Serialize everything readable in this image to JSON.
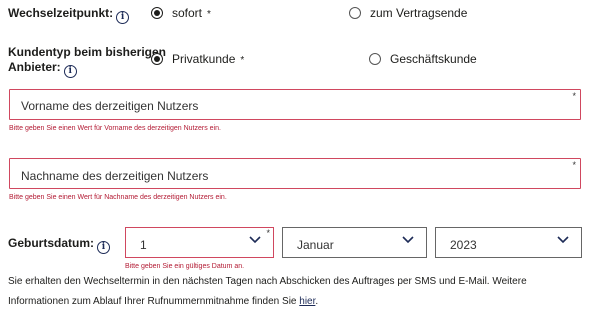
{
  "switch_time": {
    "label": "Wechselzeitpunkt:",
    "info_icon": "info-icon",
    "options": [
      {
        "label": "sofort",
        "required_mark": "*",
        "checked": true
      },
      {
        "label": "zum Vertragsende",
        "checked": false
      }
    ]
  },
  "customer_type": {
    "label_line1": "Kundentyp beim bisherigen",
    "label_line2": "Anbieter:",
    "info_icon": "info-icon",
    "options": [
      {
        "label": "Privatkunde",
        "required_mark": "*",
        "checked": true
      },
      {
        "label": "Geschäftskunde",
        "checked": false
      }
    ]
  },
  "first_name": {
    "placeholder": "Vorname des derzeitigen Nutzers",
    "required_mark": "*",
    "error": "Bitte geben Sie einen Wert für Vorname des derzeitigen Nutzers ein."
  },
  "last_name": {
    "placeholder": "Nachname des derzeitigen Nutzers",
    "required_mark": "*",
    "error": "Bitte geben Sie einen Wert für Nachname des derzeitigen Nutzers ein."
  },
  "birthdate": {
    "label": "Geburtsdatum:",
    "info_icon": "info-icon",
    "day": "1",
    "month": "Januar",
    "year": "2023",
    "required_mark": "*",
    "error": "Bitte geben Sie ein gültiges Datum an."
  },
  "note": {
    "line1": "Sie erhalten den Wechseltermin in den nächsten Tagen nach Abschicken des Auftrages per SMS und E-Mail. Weitere",
    "line2_prefix": "Informationen zum Ablauf Ihrer Rufnummernmitnahme finden Sie ",
    "link": "hier",
    "line2_suffix": "."
  },
  "colors": {
    "error": "#d0475f",
    "error_text": "#b31b34",
    "link": "#1d2b57"
  }
}
